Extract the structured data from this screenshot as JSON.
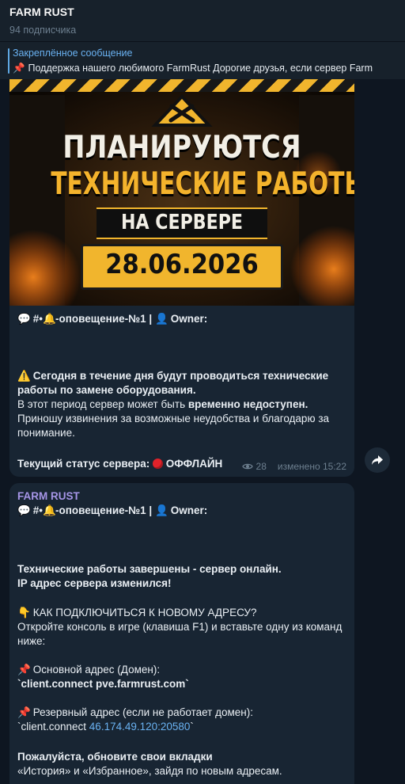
{
  "channel": {
    "title": "FARM RUST",
    "subtitle": "94 подписчика"
  },
  "pinned": {
    "title": "Закреплённое сообщение",
    "text": "Поддержка нашего любимого FarmRust   Дорогие друзья, если сервер Farm"
  },
  "message1": {
    "poster": {
      "line1": "ПЛАНИРУЮТСЯ",
      "line2": "ТЕХНИЧЕСКИЕ РАБОТЫ",
      "line3": "НА СЕРВЕРЕ",
      "date": "28.06.2026"
    },
    "header_tag": "#•",
    "header_channel": "-оповещение-№1 |",
    "header_owner": "Owner:",
    "p1_bold": "Сегодня в течение дня будут проводиться технические работы по замене оборудования.",
    "p2_start": "В этот период сервер может быть ",
    "p2_bold": "временно недоступен.",
    "p3": "Приношу извинения за возможные неудобства и благодарю за понимание.",
    "status_label": "Текущий статус сервера:",
    "status_value": "ОФФЛАЙН",
    "views": "28",
    "edited": "изменено 15:22"
  },
  "message2": {
    "sender": "FARM RUST",
    "header_tag": "#•",
    "header_channel": "-оповещение-№1 |",
    "header_owner": "Owner:",
    "line1": "Технические работы завершены - сервер онлайн.",
    "line2": "IP адрес сервера изменился!",
    "how_title": "КАК ПОДКЛЮЧИТЬСЯ К НОВОМУ АДРЕСУ?",
    "how_text": "Откройте консоль в игре (клавиша F1) и вставьте одну из команд ниже:",
    "main_label": "Основной адрес (Домен):",
    "main_cmd": "`client.connect pve.farmrust.com`",
    "backup_label": "Резервный адрес (если не работает домен):",
    "backup_cmd_start": "`client.connect ",
    "backup_ip": "46.174.49.120:20580",
    "backup_cmd_end": "`",
    "final_bold": "Пожалуйста, обновите свои вкладки",
    "final_text": "«История» и «Избранное», зайдя по новым адресам."
  },
  "colors": {
    "background": "#0e1621",
    "bubble": "#182533",
    "link": "#6ab2f2",
    "accent_yellow": "#f1b52d",
    "sender": "#a695e7"
  }
}
